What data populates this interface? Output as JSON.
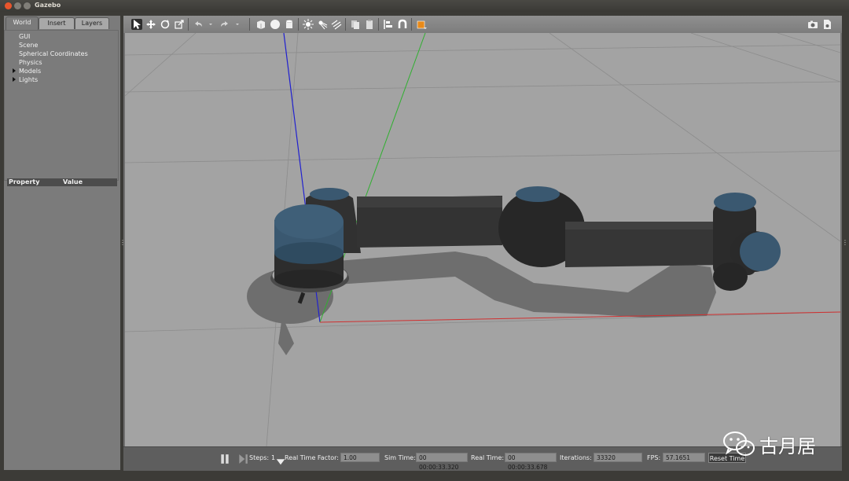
{
  "window": {
    "title": "Gazebo"
  },
  "left_panel": {
    "tabs": [
      {
        "label": "World",
        "active": true
      },
      {
        "label": "Insert",
        "active": false
      },
      {
        "label": "Layers",
        "active": false
      }
    ],
    "tree": [
      {
        "label": "GUI",
        "expandable": false
      },
      {
        "label": "Scene",
        "expandable": false
      },
      {
        "label": "Spherical Coordinates",
        "expandable": false
      },
      {
        "label": "Physics",
        "expandable": false
      },
      {
        "label": "Models",
        "expandable": true
      },
      {
        "label": "Lights",
        "expandable": true
      }
    ],
    "property_header": {
      "property": "Property",
      "value": "Value"
    }
  },
  "toolbar": {
    "tools": [
      "select-mode-icon",
      "translate-mode-icon",
      "rotate-mode-icon",
      "scale-mode-icon",
      "undo-icon",
      "undo-dropdown-icon",
      "redo-icon",
      "redo-dropdown-icon",
      "box-shape-icon",
      "sphere-shape-icon",
      "cylinder-shape-icon",
      "point-light-icon",
      "spot-light-icon",
      "directional-light-icon",
      "copy-icon",
      "paste-icon",
      "align-icon",
      "snap-icon",
      "view-angle-icon"
    ],
    "right_tools": [
      "screenshot-icon",
      "record-icon"
    ]
  },
  "bottom_bar": {
    "steps_label": "Steps:",
    "steps_value": "1",
    "real_time_factor_label": "Real Time Factor:",
    "real_time_factor_value": "1.00",
    "sim_time_label": "Sim Time:",
    "sim_time_value": "00 00:00:33.320",
    "real_time_label": "Real Time:",
    "real_time_value": "00 00:00:33.678",
    "iterations_label": "Iterations:",
    "iterations_value": "33320",
    "fps_label": "FPS:",
    "fps_value": "57.1651",
    "reset_time_label": "Reset Time"
  },
  "watermark": {
    "text": "古月居"
  },
  "colors": {
    "accent_orange": "#e88a1a",
    "ground": "#a3a3a3",
    "robot_body": "#2e2e2e",
    "robot_cap": "#3a5870",
    "axis_x": "#d03030",
    "axis_y": "#30b030",
    "axis_z": "#2020d0"
  }
}
